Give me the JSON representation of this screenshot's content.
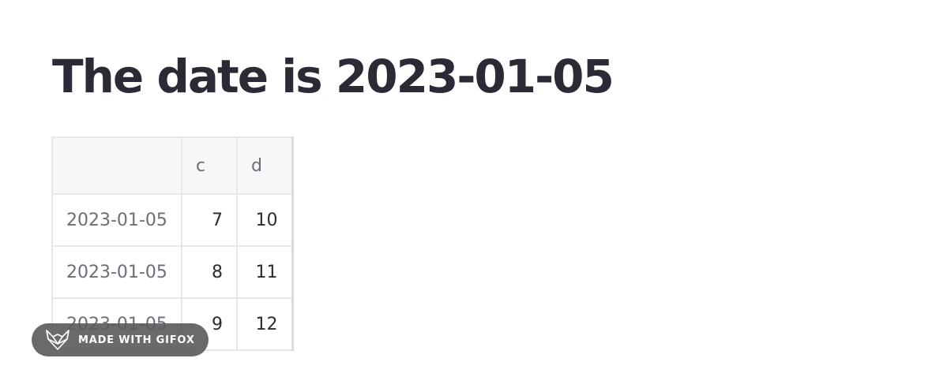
{
  "title": "The date is 2023-01-05",
  "table": {
    "columns": [
      "",
      "c",
      "d"
    ],
    "rows": [
      {
        "index": "2023-01-05",
        "c": "7",
        "d": "10"
      },
      {
        "index": "2023-01-05",
        "c": "8",
        "d": "11"
      },
      {
        "index": "2023-01-05",
        "c": "9",
        "d": "12"
      }
    ]
  },
  "watermark": {
    "label": "MADE WITH GIFOX",
    "icon": "fox-logo-icon"
  }
}
